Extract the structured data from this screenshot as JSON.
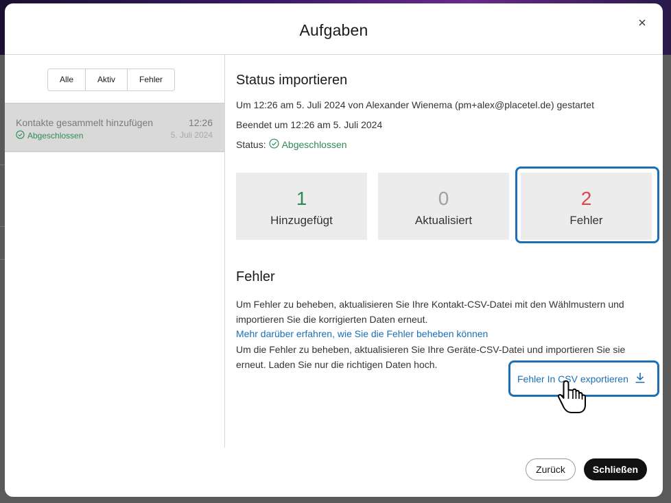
{
  "modal": {
    "title": "Aufgaben"
  },
  "filters": [
    {
      "label": "Alle"
    },
    {
      "label": "Aktiv"
    },
    {
      "label": "Fehler"
    }
  ],
  "task": {
    "name": "Kontakte gesammelt hinzufügen",
    "time": "12:26",
    "status": "Abgeschlossen",
    "date": "5. Juli 2024"
  },
  "import_status": {
    "title": "Status importieren",
    "started": "Um 12:26 am 5. Juli 2024 von Alexander Wienema (pm+alex@placetel.de) gestartet",
    "ended": "Beendet um 12:26 am 5. Juli 2024",
    "status_label": "Status:",
    "status_value": "Abgeschlossen"
  },
  "stats": [
    {
      "value": "1",
      "label": "Hinzugefügt",
      "color": "#2e8a57"
    },
    {
      "value": "0",
      "label": "Aktualisiert",
      "color": "#a0a0a0"
    },
    {
      "value": "2",
      "label": "Fehler",
      "color": "#e0454f"
    }
  ],
  "errors": {
    "title": "Fehler",
    "para1_line1": "Um Fehler zu beheben, aktualisieren Sie Ihre Kontakt-CSV-Datei mit den Wählmustern und",
    "para1_line2": "importieren Sie die korrigierten Daten erneut.",
    "learn_more": "Mehr darüber erfahren, wie Sie die Fehler beheben können",
    "para2_line1": "Um die Fehler zu beheben, aktualisieren Sie Ihre Geräte-CSV-Datei und importieren Sie sie",
    "para2_line2": "erneut. Laden Sie nur die richtigen Daten hoch.",
    "export_label": "Fehler In CSV exportieren"
  },
  "footer": {
    "back_label": "Zurück",
    "close_label": "Schließen"
  },
  "colors": {
    "accent": "#1a6fb5",
    "success": "#2e8a57",
    "error": "#e0454f"
  }
}
